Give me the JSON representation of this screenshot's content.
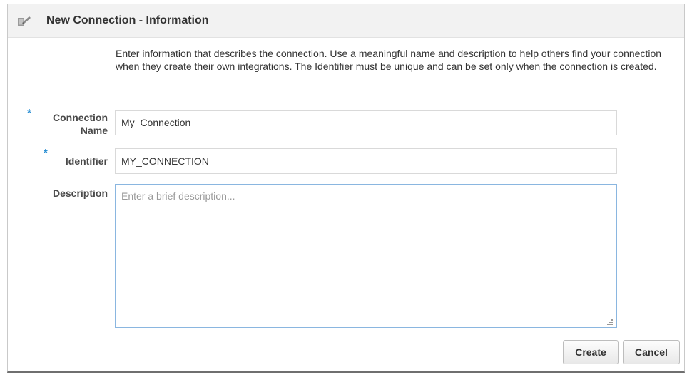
{
  "dialog": {
    "title": "New Connection - Information",
    "icon": "edit-pencil-icon",
    "instructions": "Enter information that describes the connection. Use a meaningful name and description to help others find your connection when they create their own integrations. The Identifier must be unique and can be set only when the connection is created."
  },
  "form": {
    "required_marker": "*",
    "connection_name": {
      "label_line1": "Connection",
      "label_line2": "Name",
      "value": "My_Connection",
      "required": true
    },
    "identifier": {
      "label": "Identifier",
      "value": "MY_CONNECTION",
      "required": true
    },
    "description": {
      "label": "Description",
      "value": "",
      "placeholder": "Enter a brief description..."
    }
  },
  "buttons": {
    "create_label": "Create",
    "cancel_label": "Cancel"
  },
  "colors": {
    "required_star": "#2a8fd3",
    "header_bg": "#f2f2f2",
    "focus_border": "#8ab6e0"
  }
}
